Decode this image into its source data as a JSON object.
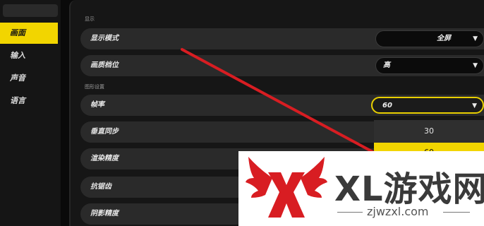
{
  "sidebar": {
    "items": [
      {
        "label": "画面",
        "active": true
      },
      {
        "label": "输入",
        "active": false
      },
      {
        "label": "声音",
        "active": false
      },
      {
        "label": "语言",
        "active": false
      }
    ]
  },
  "sections": [
    {
      "label": "显示"
    },
    {
      "label": "图形设置"
    }
  ],
  "rows": [
    {
      "label": "显示模式",
      "value": "全屏"
    },
    {
      "label": "画质档位",
      "value": "高"
    },
    {
      "label": "帧率",
      "value": "60"
    },
    {
      "label": "垂直同步"
    },
    {
      "label": "渲染精度"
    },
    {
      "label": "抗锯齿"
    },
    {
      "label": "阴影精度"
    }
  ],
  "dropdown": {
    "options": [
      "30",
      "60"
    ]
  },
  "watermark": {
    "title": "XL游戏网",
    "subtitle": "zjwzxl.com"
  },
  "colors": {
    "accent": "#f2d500",
    "arrow": "#d81d22"
  }
}
